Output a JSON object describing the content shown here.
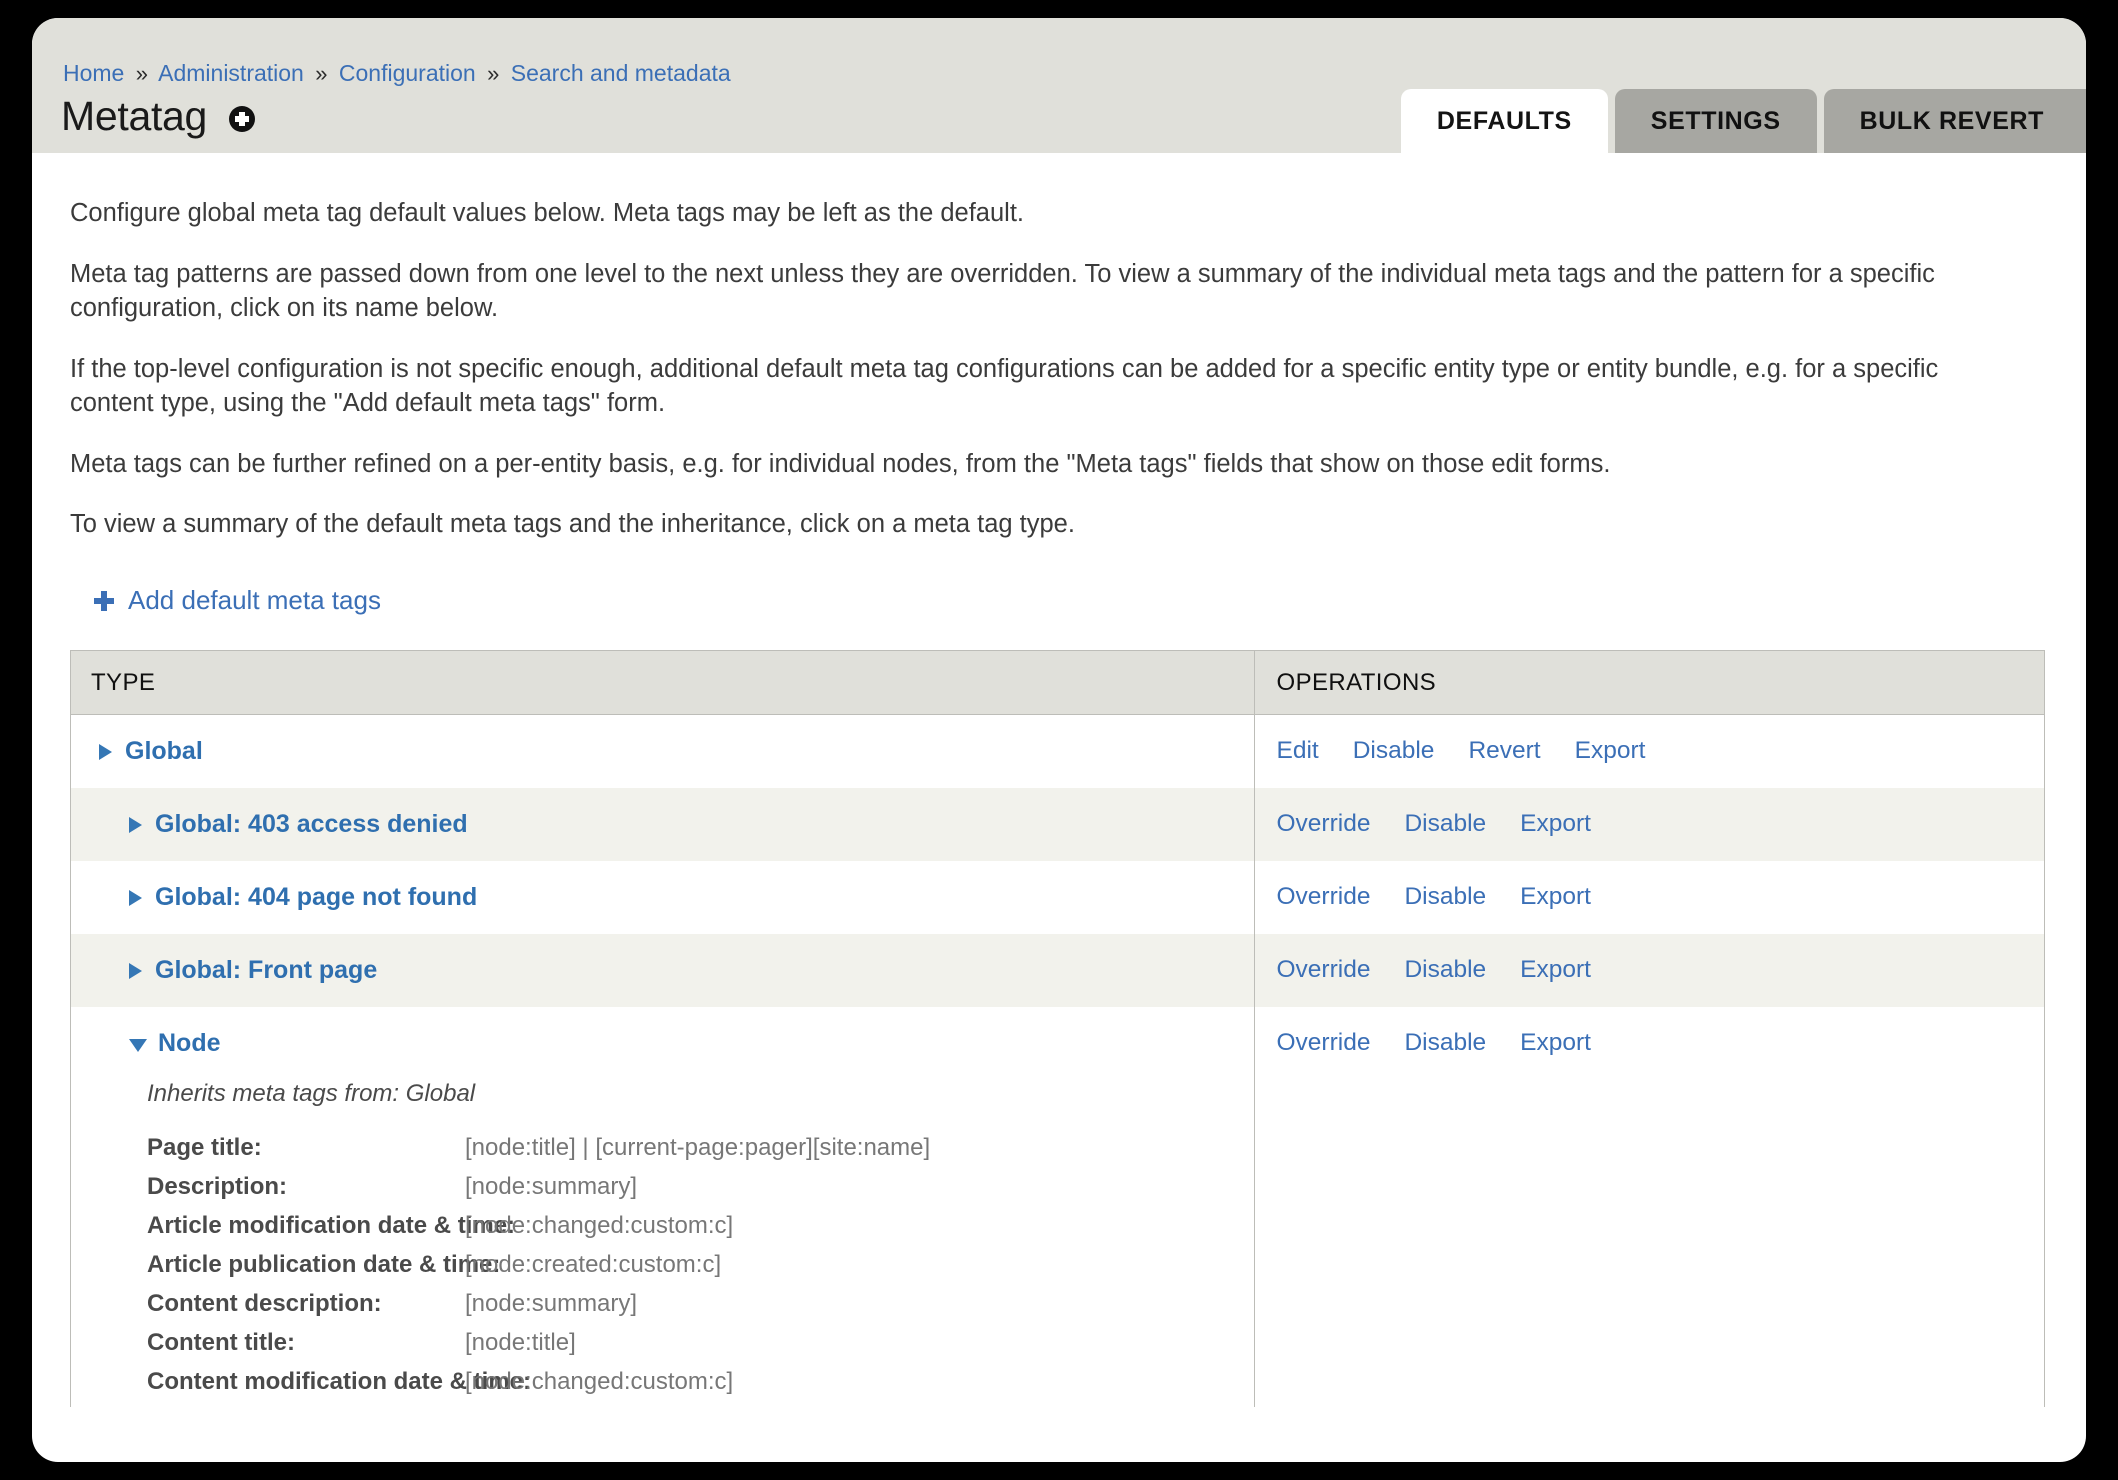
{
  "breadcrumb": {
    "items": [
      "Home",
      "Administration",
      "Configuration",
      "Search and metadata"
    ],
    "separator": "»"
  },
  "header": {
    "title": "Metatag",
    "help_icon": "plus-circle-icon"
  },
  "tabs": [
    {
      "label": "DEFAULTS",
      "active": true
    },
    {
      "label": "SETTINGS",
      "active": false
    },
    {
      "label": "BULK REVERT",
      "active": false
    }
  ],
  "intro": {
    "paragraphs": [
      "Configure global meta tag default values below. Meta tags may be left as the default.",
      "Meta tag patterns are passed down from one level to the next unless they are overridden. To view a summary of the individual meta tags and the pattern for a specific configuration, click on its name below.",
      "If the top-level configuration is not specific enough, additional default meta tag configurations can be added for a specific entity type or entity bundle, e.g. for a specific content type, using the \"Add default meta tags\" form.",
      "Meta tags can be further refined on a per-entity basis, e.g. for individual nodes, from the \"Meta tags\" fields that show on those edit forms.",
      "To view a summary of the default meta tags and the inheritance, click on a meta tag type."
    ]
  },
  "actions": {
    "add_default_meta_tags": "Add default meta tags"
  },
  "table": {
    "columns": [
      "TYPE",
      "OPERATIONS"
    ],
    "rows": [
      {
        "label": "Global",
        "indent": 0,
        "expanded": false,
        "operations": [
          "Edit",
          "Disable",
          "Revert",
          "Export"
        ]
      },
      {
        "label": "Global: 403 access denied",
        "indent": 1,
        "expanded": false,
        "operations": [
          "Override",
          "Disable",
          "Export"
        ]
      },
      {
        "label": "Global: 404 page not found",
        "indent": 1,
        "expanded": false,
        "operations": [
          "Override",
          "Disable",
          "Export"
        ]
      },
      {
        "label": "Global: Front page",
        "indent": 1,
        "expanded": false,
        "operations": [
          "Override",
          "Disable",
          "Export"
        ]
      },
      {
        "label": "Node",
        "indent": 1,
        "expanded": true,
        "operations": [
          "Override",
          "Disable",
          "Export"
        ],
        "inherits": "Inherits meta tags from: Global",
        "meta_tags": [
          {
            "key": "Page title:",
            "value": "[node:title] | [current-page:pager][site:name]"
          },
          {
            "key": "Description:",
            "value": "[node:summary]"
          },
          {
            "key": "Article modification date & time:",
            "value": "[node:changed:custom:c]"
          },
          {
            "key": "Article publication date & time:",
            "value": "[node:created:custom:c]"
          },
          {
            "key": "Content description:",
            "value": "[node:summary]"
          },
          {
            "key": "Content title:",
            "value": "[node:title]"
          },
          {
            "key": "Content modification date & time:",
            "value": "[node:changed:custom:c]"
          }
        ]
      }
    ]
  },
  "colors": {
    "link": "#3b6fb6",
    "header_bg": "#e0e0da",
    "tab_inactive": "#a7a7a2",
    "row_alt": "#f2f2ec",
    "border": "#bdbdb8"
  }
}
